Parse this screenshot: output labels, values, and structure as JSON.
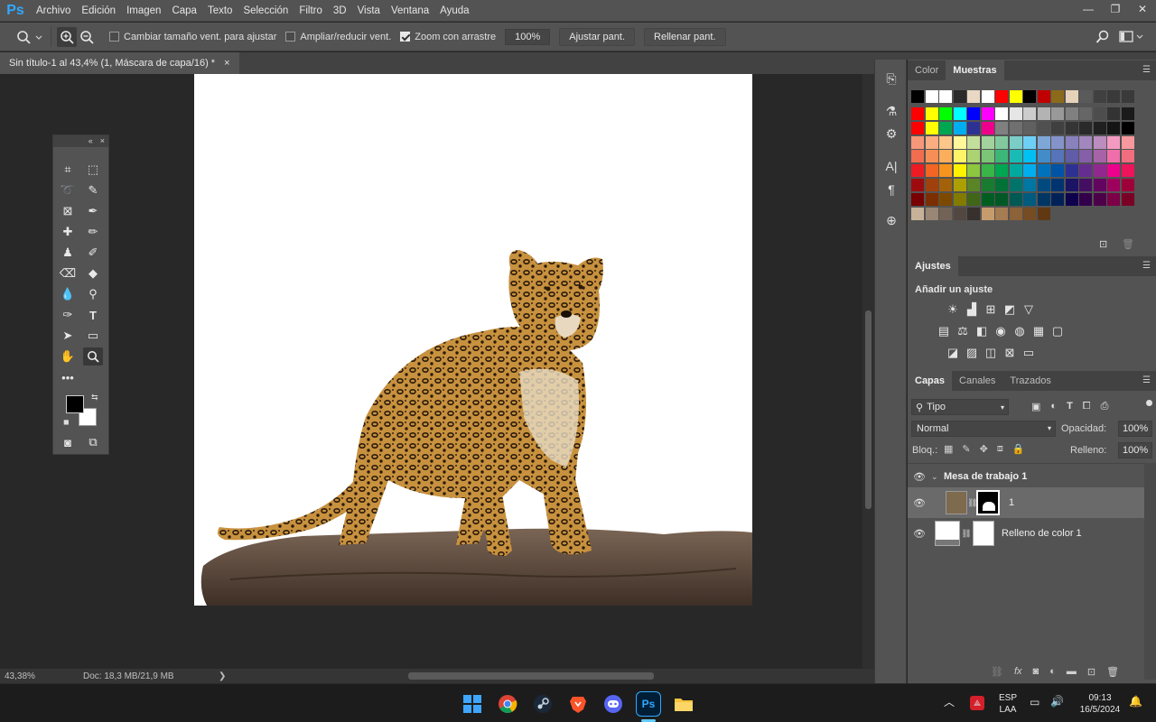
{
  "app": {
    "logo": "Ps"
  },
  "menu": [
    "Archivo",
    "Edición",
    "Imagen",
    "Capa",
    "Texto",
    "Selección",
    "Filtro",
    "3D",
    "Vista",
    "Ventana",
    "Ayuda"
  ],
  "window_controls": {
    "minimize": "—",
    "restore": "❐",
    "close": "✕"
  },
  "options": {
    "resize_windows_label": "Cambiar tamaño vent. para ajustar",
    "resize_windows_checked": false,
    "zoom_all_label": "Ampliar/reducir vent.",
    "zoom_all_checked": false,
    "scrubby_label": "Zoom con arrastre",
    "scrubby_checked": true,
    "zoom_value": "100%",
    "fit_screen": "Ajustar pant.",
    "fill_screen": "Rellenar pant."
  },
  "document": {
    "tab_title": "Sin título-1 al 43,4% (1, Máscara de capa/16) *",
    "close_glyph": "×"
  },
  "status": {
    "zoom": "43,38%",
    "doc_info": "Doc: 18,3 MB/21,9 MB",
    "arrow": "❯"
  },
  "tools_header": {
    "collapse": "«",
    "close": "×"
  },
  "color_panel": {
    "tabs": [
      "Color",
      "Muestras"
    ],
    "active_tab": "Muestras",
    "top_row": [
      "#000000",
      "#ffffff",
      "#ffffff",
      "#2a2a2a",
      "#e9d8c4",
      "#ffffff",
      "#ff0000",
      "#ffff00",
      "#000000",
      "#c00000",
      "#8b6a1a",
      "#e6d2b8",
      "#5a5a5a",
      "#404040",
      "#3a3a3a",
      "#3a3a3a"
    ],
    "rows": [
      [
        "#ff0000",
        "#ffff00",
        "#00ff00",
        "#00ffff",
        "#0000ff",
        "#ff00ff",
        "#ffffff",
        "#e6e6e6",
        "#cccccc",
        "#b3b3b3",
        "#999999",
        "#808080",
        "#666666",
        "#4d4d4d",
        "#333333",
        "#1a1a1a"
      ],
      [
        "#ff0000",
        "#ffff00",
        "#00a651",
        "#00aeef",
        "#2e3192",
        "#ec008c",
        "#808080",
        "#707070",
        "#606060",
        "#505050",
        "#404040",
        "#353535",
        "#2a2a2a",
        "#202020",
        "#151515",
        "#000000"
      ],
      [
        "#f7977a",
        "#f9ad81",
        "#fdc68a",
        "#fff79a",
        "#c4df9b",
        "#a3d39c",
        "#82ca9d",
        "#7bcdc8",
        "#6ecff6",
        "#7ea7d8",
        "#8493ca",
        "#8882be",
        "#a187be",
        "#bc8dbf",
        "#f49ac2",
        "#f6989d"
      ],
      [
        "#f26c4f",
        "#f68e55",
        "#fbaf5c",
        "#fff467",
        "#acd372",
        "#7cc576",
        "#3bb878",
        "#1abbb4",
        "#00bff3",
        "#438cca",
        "#5574b9",
        "#605ca8",
        "#855fa8",
        "#a763a8",
        "#f06ea9",
        "#f26d7d"
      ],
      [
        "#ed1c24",
        "#f26522",
        "#f7941d",
        "#fff200",
        "#8dc63f",
        "#39b54a",
        "#00a651",
        "#00a99d",
        "#00aeef",
        "#0072bc",
        "#0054a6",
        "#2e3192",
        "#662d91",
        "#92278f",
        "#ec008c",
        "#ed145b"
      ],
      [
        "#9e0b0f",
        "#a0410d",
        "#a3620a",
        "#aba000",
        "#598527",
        "#197b30",
        "#007236",
        "#00746b",
        "#0076a3",
        "#004a80",
        "#003471",
        "#1b1464",
        "#440e62",
        "#630460",
        "#9e005d",
        "#9e0039"
      ],
      [
        "#790000",
        "#7b2e00",
        "#7d4900",
        "#827b00",
        "#406618",
        "#005e20",
        "#005826",
        "#005952",
        "#005b7f",
        "#003663",
        "#002157",
        "#0d004c",
        "#32004b",
        "#4b0049",
        "#7b0046",
        "#7a0026"
      ],
      [
        "#c7b299",
        "#998675",
        "#736357",
        "#534741",
        "#37302d",
        "#c69c6d",
        "#a67c52",
        "#8c6239",
        "#754c24",
        "#603913"
      ]
    ]
  },
  "adjustments": {
    "tab": "Ajustes",
    "title": "Añadir un ajuste",
    "rows": [
      [
        "brightness-icon",
        "levels-icon",
        "curves-icon",
        "exposure-icon",
        "gradient-triangle-icon"
      ],
      [
        "vibrance-icon",
        "hue-icon",
        "color-balance-icon",
        "bw-icon",
        "photo-filter-icon",
        "channel-mixer-icon",
        "color-lookup-icon"
      ],
      [
        "invert-icon",
        "posterize-icon",
        "threshold-icon",
        "selective-color-icon",
        "gradient-map-icon"
      ]
    ],
    "glyphs": [
      [
        "☀",
        "▟",
        "⊞",
        "◩",
        "▽"
      ],
      [
        "▤",
        "⚖",
        "◧",
        "◉",
        "◍",
        "▦"
      ],
      [
        "◪",
        "▨",
        "◫",
        "⊠",
        "▭"
      ]
    ]
  },
  "layers": {
    "tabs": [
      "Capas",
      "Canales",
      "Trazados"
    ],
    "active_tab": "Capas",
    "filter": "Tipo",
    "blend_mode": "Normal",
    "opacity_label": "Opacidad:",
    "opacity": "100%",
    "lock_label": "Bloq.:",
    "fill_label": "Relleno:",
    "fill": "100%",
    "group_name": "Mesa de trabajo 1",
    "layer1_name": "1",
    "layer2_name": "Relleno de color 1"
  },
  "taskbar": {
    "lang": "ESP",
    "lang_sub": "LAA",
    "time": "09:13",
    "date": "16/5/2024",
    "ps_label": "Ps"
  },
  "colors": {
    "accent": "#31a8ff",
    "panel": "#535353",
    "dark": "#282828"
  }
}
